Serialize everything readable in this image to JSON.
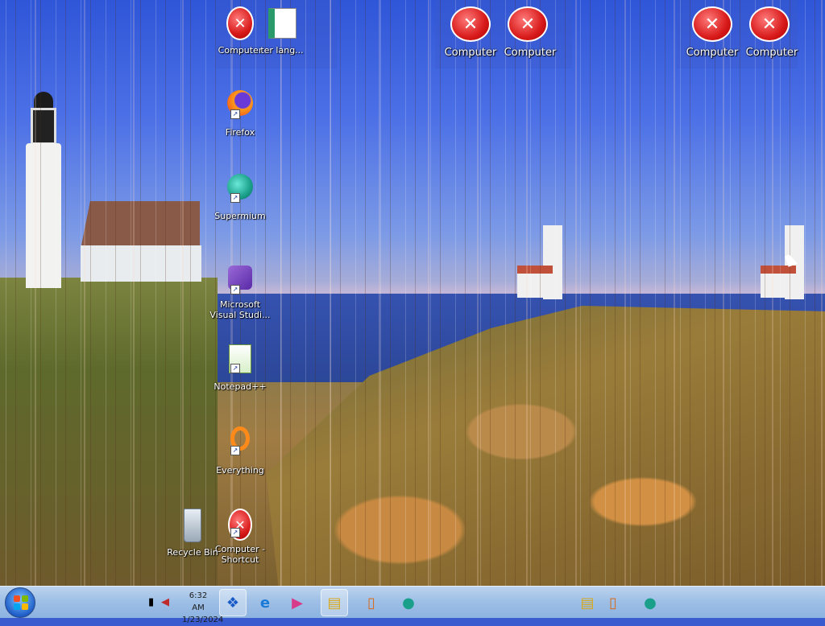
{
  "desktop": {
    "icons_column": [
      {
        "label": "Computer"
      },
      {
        "label": "Firefox"
      },
      {
        "label": "Supermium"
      },
      {
        "label": "Microsoft Visual Studi..."
      },
      {
        "label": "Notepad++"
      },
      {
        "label": "Everything"
      },
      {
        "label": "Computer - Shortcut"
      }
    ],
    "top_icons": [
      {
        "label": "ter lang..."
      },
      {
        "label": "Computer"
      },
      {
        "label": "Computer"
      },
      {
        "label": "Computer"
      },
      {
        "label": "Computer"
      }
    ],
    "recycle_bin": {
      "label": "Recycle Bin"
    }
  },
  "taskbar": {
    "clock_time": "6:32 AM",
    "clock_date": "1/23/2024",
    "apps": [
      {
        "icon": "windows-media-icon"
      },
      {
        "icon": "internet-explorer-icon"
      },
      {
        "icon": "media-player-icon"
      },
      {
        "icon": "file-explorer-icon"
      },
      {
        "icon": "notepad-icon"
      },
      {
        "icon": "supermium-icon"
      }
    ]
  },
  "colors": {
    "taskbar": "#9fc0e6",
    "error_red": "#d81a1a"
  }
}
